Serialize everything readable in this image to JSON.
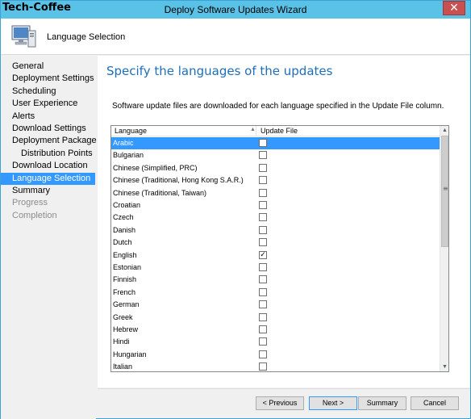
{
  "brand": "Tech-Coffee",
  "window": {
    "title": "Deploy Software Updates Wizard",
    "close_glyph": "✕"
  },
  "header": {
    "icon": "computer-icon",
    "title": "Language Selection"
  },
  "nav": [
    {
      "label": "General",
      "state": "normal",
      "indent": false
    },
    {
      "label": "Deployment Settings",
      "state": "normal",
      "indent": false
    },
    {
      "label": "Scheduling",
      "state": "normal",
      "indent": false
    },
    {
      "label": "User Experience",
      "state": "normal",
      "indent": false
    },
    {
      "label": "Alerts",
      "state": "normal",
      "indent": false
    },
    {
      "label": "Download Settings",
      "state": "normal",
      "indent": false
    },
    {
      "label": "Deployment Package",
      "state": "normal",
      "indent": false
    },
    {
      "label": "Distribution Points",
      "state": "normal",
      "indent": true
    },
    {
      "label": "Download Location",
      "state": "normal",
      "indent": false
    },
    {
      "label": "Language Selection",
      "state": "selected",
      "indent": false
    },
    {
      "label": "Summary",
      "state": "normal",
      "indent": false
    },
    {
      "label": "Progress",
      "state": "disabled",
      "indent": false
    },
    {
      "label": "Completion",
      "state": "disabled",
      "indent": false
    }
  ],
  "content": {
    "title": "Specify the languages of the updates",
    "description": "Software update files are downloaded for each language specified in the Update File column."
  },
  "grid": {
    "columns": [
      "Language",
      "Update File"
    ],
    "rows": [
      {
        "language": "Arabic",
        "checked": false,
        "selected": true
      },
      {
        "language": "Bulgarian",
        "checked": false,
        "selected": false
      },
      {
        "language": "Chinese (Simplified, PRC)",
        "checked": false,
        "selected": false
      },
      {
        "language": "Chinese (Traditional, Hong Kong S.A.R.)",
        "checked": false,
        "selected": false
      },
      {
        "language": "Chinese (Traditional, Taiwan)",
        "checked": false,
        "selected": false
      },
      {
        "language": "Croatian",
        "checked": false,
        "selected": false
      },
      {
        "language": "Czech",
        "checked": false,
        "selected": false
      },
      {
        "language": "Danish",
        "checked": false,
        "selected": false
      },
      {
        "language": "Dutch",
        "checked": false,
        "selected": false
      },
      {
        "language": "English",
        "checked": true,
        "selected": false
      },
      {
        "language": "Estonian",
        "checked": false,
        "selected": false
      },
      {
        "language": "Finnish",
        "checked": false,
        "selected": false
      },
      {
        "language": "French",
        "checked": false,
        "selected": false
      },
      {
        "language": "German",
        "checked": false,
        "selected": false
      },
      {
        "language": "Greek",
        "checked": false,
        "selected": false
      },
      {
        "language": "Hebrew",
        "checked": false,
        "selected": false
      },
      {
        "language": "Hindi",
        "checked": false,
        "selected": false
      },
      {
        "language": "Hungarian",
        "checked": false,
        "selected": false
      },
      {
        "language": "Italian",
        "checked": false,
        "selected": false
      }
    ]
  },
  "buttons": {
    "previous": "< Previous",
    "next": "Next >",
    "summary": "Summary",
    "cancel": "Cancel"
  },
  "colors": {
    "accent": "#3399ff",
    "titlebar": "#5bc2e7",
    "heading": "#1f6fb7"
  }
}
